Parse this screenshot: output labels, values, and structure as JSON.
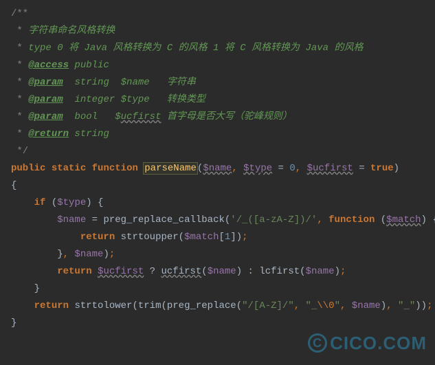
{
  "docblock": {
    "open": "/**",
    "l1_star": " * ",
    "l1_text": "字符串命名风格转换",
    "l2_star": " * ",
    "l2_text": "type 0 将 Java 风格转换为 C 的风格 1 将 C 风格转换为 Java 的风格",
    "l3_star": " * ",
    "l3_tag": "@access",
    "l3_rest": " public",
    "l4_star": " * ",
    "l4_tag": "@param",
    "l4_rest": "  string  $name   字符串",
    "l5_star": " * ",
    "l5_tag": "@param",
    "l5_rest": "  integer $type   转换类型",
    "l6_star": " * ",
    "l6_tag": "@param",
    "l6_rest": "  bool   $",
    "l6_ucfirst": "ucfirst",
    "l6_rest2": " 首字母是否大写（驼峰规则）",
    "l7_star": " * ",
    "l7_tag": "@return",
    "l7_rest": " string",
    "close": " */"
  },
  "sig": {
    "kw_public": "public",
    "kw_static": "static",
    "kw_function": "function",
    "fn_name": "parseName",
    "open_paren": "(",
    "p_name": "$name",
    "sep1": ", ",
    "p_type": "$type",
    "eq1": " = ",
    "zero": "0",
    "sep2": ", ",
    "p_ucfirst": "$ucfirst",
    "eq2": " = ",
    "true": "true",
    "close_paren": ")"
  },
  "body": {
    "brace_open": "{",
    "if_indent": "    ",
    "kw_if": "if",
    "if_open": " (",
    "if_var": "$type",
    "if_close": ") {",
    "a_indent": "        ",
    "a_var": "$name",
    "a_eq": " = ",
    "a_fn": "preg_replace_callback",
    "a_open": "(",
    "a_str": "'/_([a-zA-Z])/'",
    "a_sep": ", ",
    "a_kw_fn": "function",
    "a_sp": " ",
    "a_paren_o": "(",
    "a_match": "$match",
    "a_paren_c": ")",
    "a_brace": " {",
    "r_indent": "            ",
    "r_kw": "return",
    "r_sp": " ",
    "r_fn": "strtoupper",
    "r_open": "(",
    "r_var": "$match",
    "r_br_o": "[",
    "r_idx": "1",
    "r_br_c": "]",
    "r_close": ")",
    "r_semi": ";",
    "cb_indent": "        ",
    "cb_close": "}",
    "cb_sep": ", ",
    "cb_var": "$name",
    "cb_paren": ")",
    "cb_semi": ";",
    "blank": "",
    "ret2_indent": "        ",
    "ret2_kw": "return",
    "ret2_sp": " ",
    "ret2_var1": "$ucfirst",
    "ret2_q": " ? ",
    "ret2_fn1": "ucfirst",
    "ret2_o1": "(",
    "ret2_v1": "$name",
    "ret2_c1": ")",
    "ret2_colon": " : ",
    "ret2_fn2": "lcfirst",
    "ret2_o2": "(",
    "ret2_v2": "$name",
    "ret2_c2": ")",
    "ret2_semi": ";",
    "if_end_indent": "    ",
    "if_end": "}",
    "ret3_indent": "    ",
    "ret3_kw": "return",
    "ret3_sp": " ",
    "ret3_fn1": "strtolower",
    "ret3_o1": "(",
    "ret3_fn2": "trim",
    "ret3_o2": "(",
    "ret3_fn3": "preg_replace",
    "ret3_o3": "(",
    "ret3_s1": "\"/[A-Z]/\"",
    "ret3_sep1": ", ",
    "ret3_s2a": "\"_",
    "ret3_s2b": "\\\\0",
    "ret3_s2c": "\"",
    "ret3_sep2": ", ",
    "ret3_v": "$name",
    "ret3_c3": ")",
    "ret3_sep3": ", ",
    "ret3_s3": "\"_\"",
    "ret3_c2": ")",
    "ret3_c1": ")",
    "ret3_semi": ";",
    "brace_close": "}"
  },
  "watermark": {
    "at": "C",
    "text": "CICO.COM"
  }
}
